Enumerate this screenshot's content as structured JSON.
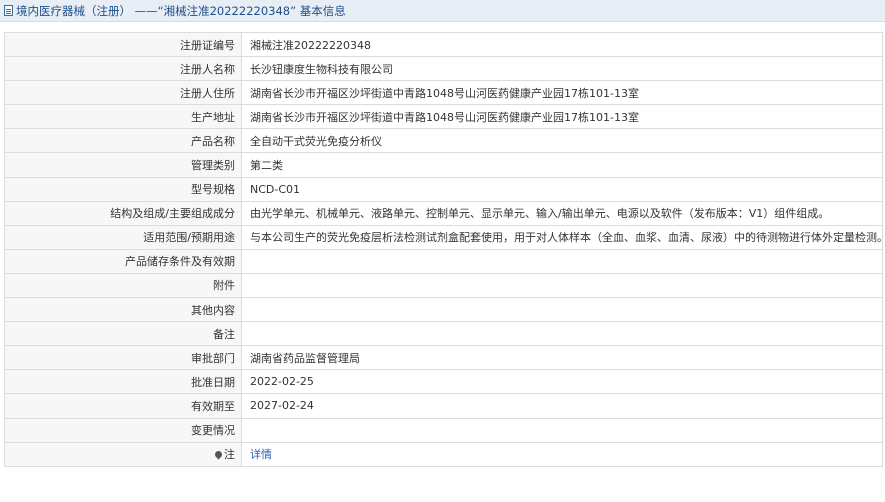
{
  "header": {
    "breadcrumb": "境内医疗器械（注册） ——“湘械注准20222220348” 基本信息"
  },
  "rows": [
    {
      "label": "注册证编号",
      "value": "湘械注准20222220348"
    },
    {
      "label": "注册人名称",
      "value": "长沙钮康度生物科技有限公司"
    },
    {
      "label": "注册人住所",
      "value": "湖南省长沙市开福区沙坪街道中青路1048号山河医药健康产业园17栋101-13室"
    },
    {
      "label": "生产地址",
      "value": "湖南省长沙市开福区沙坪街道中青路1048号山河医药健康产业园17栋101-13室"
    },
    {
      "label": "产品名称",
      "value": "全自动干式荧光免疫分析仪"
    },
    {
      "label": "管理类别",
      "value": "第二类"
    },
    {
      "label": "型号规格",
      "value": "NCD-C01"
    },
    {
      "label": "结构及组成/主要组成成分",
      "value": "由光学单元、机械单元、液路单元、控制单元、显示单元、输入/输出单元、电源以及软件（发布版本：V1）组件组成。"
    },
    {
      "label": "适用范围/预期用途",
      "value": "与本公司生产的荧光免疫层析法检测试剂盒配套使用，用于对人体样本（全血、血浆、血清、尿液）中的待测物进行体外定量检测。"
    },
    {
      "label": "产品储存条件及有效期",
      "value": ""
    },
    {
      "label": "附件",
      "value": ""
    },
    {
      "label": "其他内容",
      "value": ""
    },
    {
      "label": "备注",
      "value": ""
    },
    {
      "label": "审批部门",
      "value": "湖南省药品监督管理局"
    },
    {
      "label": "批准日期",
      "value": "2022-02-25"
    },
    {
      "label": "有效期至",
      "value": "2027-02-24"
    },
    {
      "label": "变更情况",
      "value": ""
    }
  ],
  "note_row": {
    "label": "注",
    "link_text": "详情",
    "icon": "map-pin-icon"
  },
  "colors": {
    "header_bg": "#e8eef5",
    "header_text": "#1f4e8c",
    "label_bg": "#f7f7f7",
    "border": "#dcdcdc",
    "link": "#2a63b8"
  }
}
